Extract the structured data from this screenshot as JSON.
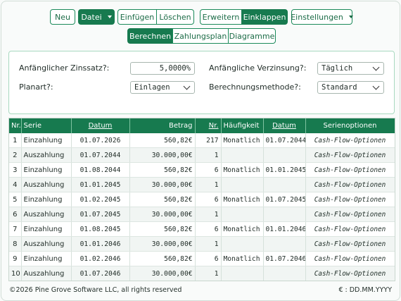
{
  "toolbar": {
    "neu": "Neu",
    "datei": "Datei",
    "einfuegen": "Einfügen",
    "loeschen": "Löschen",
    "erweitern": "Erweitern",
    "einklappen": "Einklappen",
    "einstellungen": "Einstellungen"
  },
  "tabs": {
    "berechnen": "Berechnen",
    "zahlungsplan": "Zahlungsplan",
    "diagramme": "Diagramme"
  },
  "form": {
    "zinssatz_label": "Anfänglicher Zinssatz?:",
    "zinssatz_value": "5,0000%",
    "verzinsung_label": "Anfängliche Verzinsung?:",
    "verzinsung_value": "Täglich",
    "planart_label": "Planart?:",
    "planart_value": "Einlagen",
    "methode_label": "Berechnungsmethode?:",
    "methode_value": "Standard"
  },
  "table": {
    "headers": [
      "Nr.",
      "Serie",
      "Datum",
      "Betrag",
      "Nr.",
      "Häufigkeit",
      "Datum",
      "Serienoptionen"
    ],
    "rows": [
      [
        "1",
        "Einzahlung",
        "01.07.2026",
        "560,82€",
        "217",
        "Monatlich",
        "01.07.2044",
        "Cash-Flow-Optionen"
      ],
      [
        "2",
        "Auszahlung",
        "01.07.2044",
        "30.000,00€",
        "1",
        "",
        "",
        "Cash-Flow-Optionen"
      ],
      [
        "3",
        "Einzahlung",
        "01.08.2044",
        "560,82€",
        "6",
        "Monatlich",
        "01.01.2045",
        "Cash-Flow-Optionen"
      ],
      [
        "4",
        "Auszahlung",
        "01.01.2045",
        "30.000,00€",
        "1",
        "",
        "",
        "Cash-Flow-Optionen"
      ],
      [
        "5",
        "Einzahlung",
        "01.02.2045",
        "560,82€",
        "6",
        "Monatlich",
        "01.07.2045",
        "Cash-Flow-Optionen"
      ],
      [
        "6",
        "Auszahlung",
        "01.07.2045",
        "30.000,00€",
        "1",
        "",
        "",
        "Cash-Flow-Optionen"
      ],
      [
        "7",
        "Einzahlung",
        "01.08.2045",
        "560,82€",
        "6",
        "Monatlich",
        "01.01.2046",
        "Cash-Flow-Optionen"
      ],
      [
        "8",
        "Auszahlung",
        "01.01.2046",
        "30.000,00€",
        "1",
        "",
        "",
        "Cash-Flow-Optionen"
      ],
      [
        "9",
        "Einzahlung",
        "01.02.2046",
        "560,82€",
        "6",
        "Monatlich",
        "01.07.2046",
        "Cash-Flow-Optionen"
      ],
      [
        "10",
        "Auszahlung",
        "01.07.2046",
        "30.000,00€",
        "1",
        "",
        "",
        "Cash-Flow-Optionen"
      ]
    ]
  },
  "footer": {
    "copyright": "©2026 Pine Grove Software LLC, all rights reserved",
    "format": "€ : DD.MM.YYYY"
  }
}
